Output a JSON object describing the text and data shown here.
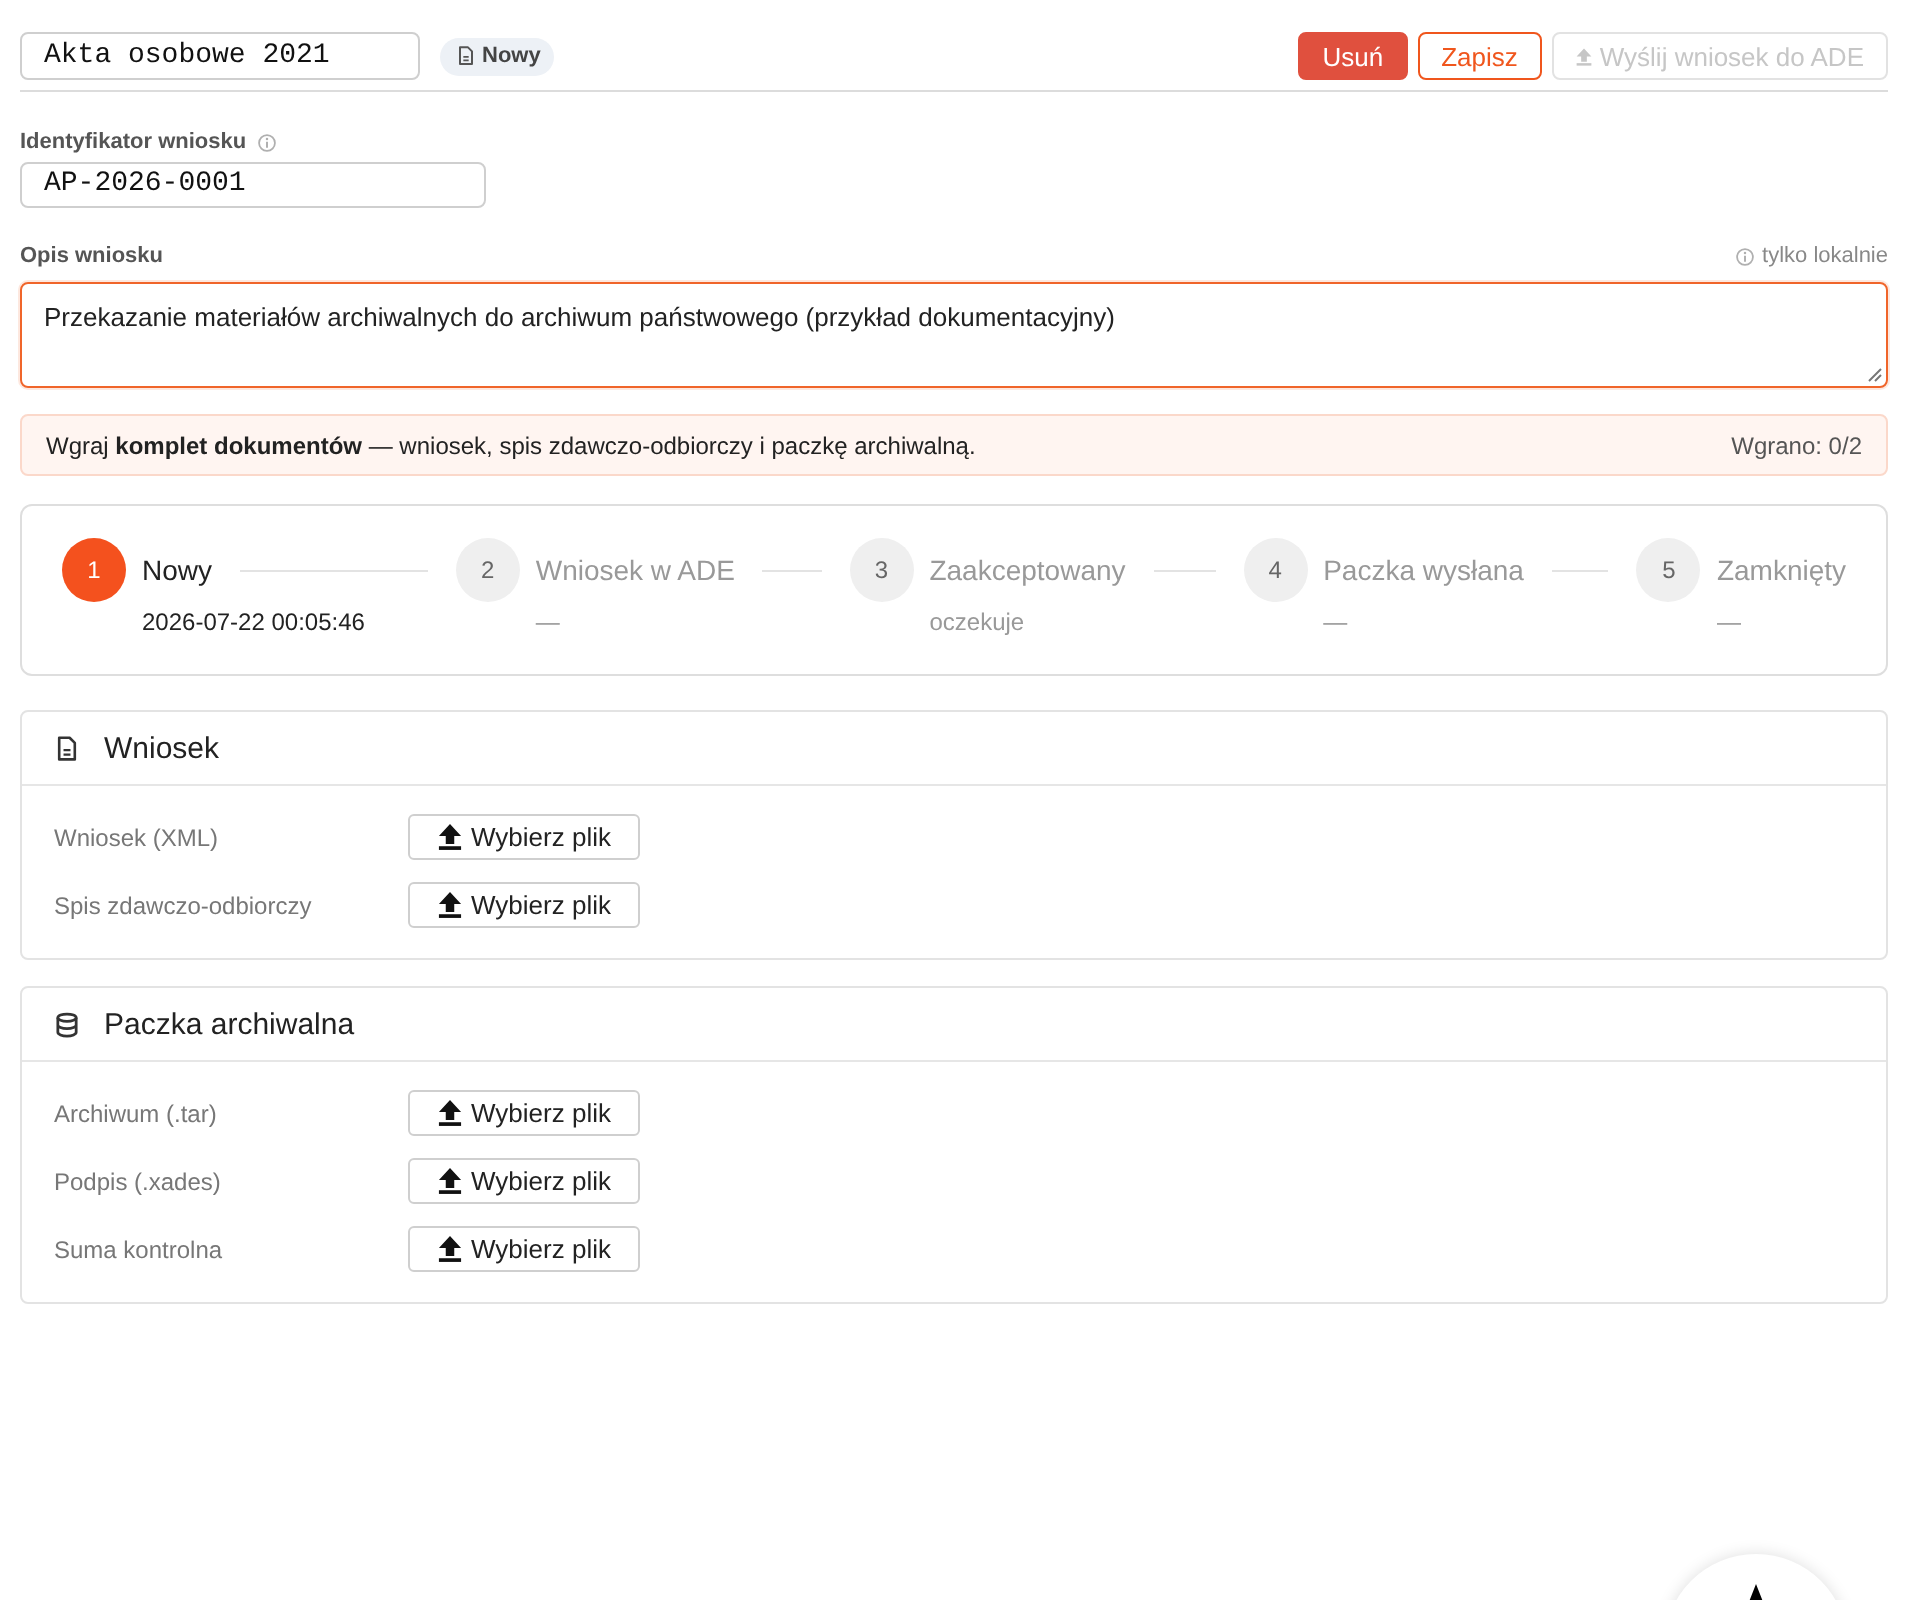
{
  "header": {
    "title": "Akta osobowe 2021",
    "status": {
      "label": "Nowy"
    },
    "buttons": [
      {
        "kind": "danger",
        "label": "Usuń",
        "disabled": false
      },
      {
        "kind": "outline",
        "label": "Zapisz",
        "disabled": false
      },
      {
        "kind": "upload",
        "label": "Wyślij wniosek do ADE",
        "disabled": true
      }
    ]
  },
  "identifier": {
    "label": "Identyfikator wniosku",
    "value": "AP-2026-0001"
  },
  "description": {
    "label": "Opis wniosku",
    "note": "tylko lokalnie",
    "value": "Przekazanie materiałów archiwalnych do archiwum państwowego (przykład dokumentacyjny)",
    "focused": true
  },
  "notice": {
    "text": "Wgraj **komplet dokumentów** — wniosek, spis zdawczo-odbiorczy i paczkę archiwalną.",
    "count": "Wgrano: 0/2"
  },
  "steps": [
    {
      "number": "1",
      "title": "Nowy",
      "detail": "2026-07-22 00:05:46",
      "active": true
    },
    {
      "number": "2",
      "title": "Wniosek w ADE",
      "detail": "—",
      "active": false
    },
    {
      "number": "3",
      "title": "Zaakceptowany",
      "detail": "oczekuje",
      "active": false
    },
    {
      "number": "4",
      "title": "Paczka wysłana",
      "detail": "—",
      "active": false
    },
    {
      "number": "5",
      "title": "Zamknięty",
      "detail": "—",
      "active": false
    }
  ],
  "sections": [
    {
      "kind": "document",
      "title": "Wniosek",
      "files": [
        {
          "label": "Wniosek (XML)",
          "button": "Wybierz plik"
        },
        {
          "label": "Spis zdawczo-odbiorczy",
          "button": "Wybierz plik"
        }
      ]
    },
    {
      "kind": "database",
      "title": "Paczka archiwalna",
      "files": [
        {
          "label": "Archiwum (.tar)",
          "button": "Wybierz plik"
        },
        {
          "label": "Podpis (.xades)",
          "button": "Wybierz plik"
        },
        {
          "label": "Suma kontrolna",
          "button": "Wybierz plik"
        }
      ]
    }
  ]
}
